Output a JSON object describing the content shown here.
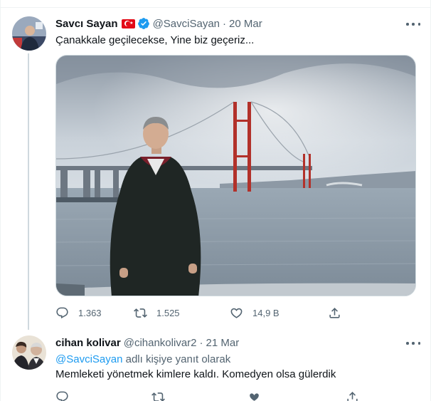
{
  "tweets": [
    {
      "name": "Savcı Sayan",
      "handle": "@SavciSayan",
      "date": "20 Mar",
      "text": "Çanakkale geçilecekse, Yine biz geçeriz...",
      "stats": {
        "replies": "1.363",
        "retweets": "1.525",
        "likes": "14,9 B"
      }
    },
    {
      "name": "cihan kolivar",
      "handle": "@cihankolivar2",
      "date": "21 Mar",
      "reply_mention": "@SavciSayan",
      "reply_suffix": "adlı kişiye yanıt olarak",
      "text": "Memleketi yönetmek kimlere kaldı. Komedyen olsa gülerdik"
    }
  ],
  "separator": "·",
  "colors": {
    "accent": "#1d9bf0",
    "muted": "#536471",
    "text": "#0f1419",
    "flag_red": "#e30a17"
  }
}
